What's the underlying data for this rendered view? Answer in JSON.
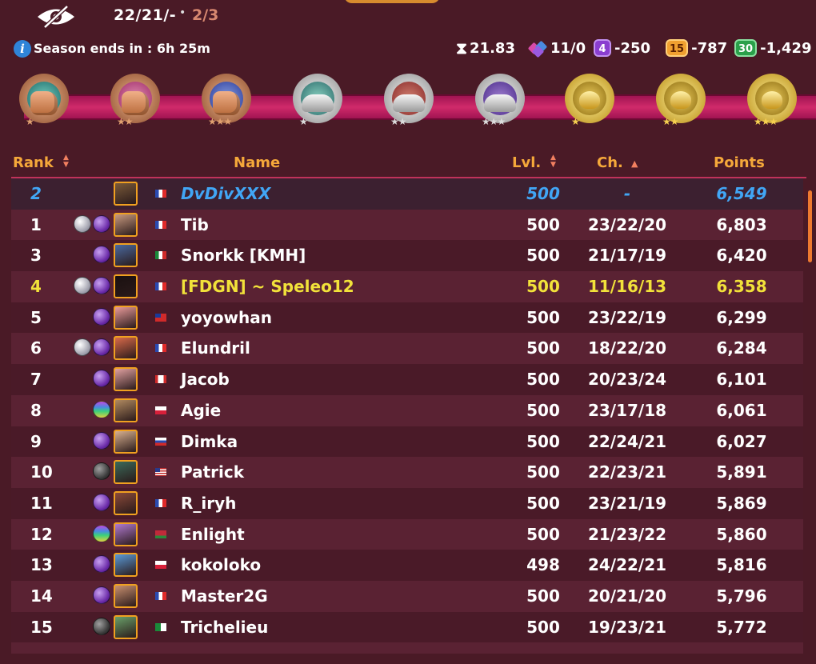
{
  "header": {
    "challenges": "22/21/-",
    "progress": "2/3",
    "season_label": "Season ends in : 6h 25m",
    "stats": [
      {
        "icon": "hourglass-icon",
        "value": "21.83"
      },
      {
        "icon": "gems-icon",
        "value": "11/0"
      },
      {
        "badge": "4",
        "badge_color": "#8a3ecf",
        "value": "-250"
      },
      {
        "badge": "15",
        "badge_color": "#f0a030",
        "value": "-787"
      },
      {
        "badge": "30",
        "badge_color": "#2aa04a",
        "value": "-1,429"
      }
    ]
  },
  "columns": {
    "rank": "Rank",
    "name": "Name",
    "lvl": "Lvl.",
    "ch": "Ch.",
    "points": "Points"
  },
  "rows": [
    {
      "rank": "2",
      "name": "DvDivXXX",
      "lvl": "500",
      "ch": "-",
      "points": "6,549",
      "style": "me",
      "orbs": [],
      "avatar": "#7a5a3a",
      "flag": "fr"
    },
    {
      "rank": "1",
      "name": "Tib",
      "lvl": "500",
      "ch": "23/22/20",
      "points": "6,803",
      "style": "",
      "orbs": [
        "silver",
        "purple"
      ],
      "avatar": "#c89a80",
      "flag": "fr"
    },
    {
      "rank": "3",
      "name": "Snorkk [KMH]",
      "lvl": "500",
      "ch": "21/17/19",
      "points": "6,420",
      "style": "",
      "orbs": [
        "purple"
      ],
      "avatar": "#4a6aa0",
      "flag": "mx"
    },
    {
      "rank": "4",
      "name": "[FDGN] ~ Speleo12",
      "lvl": "500",
      "ch": "11/16/13",
      "points": "6,358",
      "style": "highlight",
      "orbs": [
        "silver",
        "purple"
      ],
      "avatar": "#1a1010",
      "flag": "fr"
    },
    {
      "rank": "5",
      "name": "yoyowhan",
      "lvl": "500",
      "ch": "23/22/19",
      "points": "6,299",
      "style": "",
      "orbs": [
        "purple"
      ],
      "avatar": "#e89a9a",
      "flag": "tw"
    },
    {
      "rank": "6",
      "name": "Elundril",
      "lvl": "500",
      "ch": "18/22/20",
      "points": "6,284",
      "style": "",
      "orbs": [
        "silver",
        "purple"
      ],
      "avatar": "#d86a4a",
      "flag": "fr"
    },
    {
      "rank": "7",
      "name": "Jacob",
      "lvl": "500",
      "ch": "20/23/24",
      "points": "6,101",
      "style": "",
      "orbs": [
        "purple"
      ],
      "avatar": "#e0a0a0",
      "flag": "ca"
    },
    {
      "rank": "8",
      "name": "Agie",
      "lvl": "500",
      "ch": "23/17/18",
      "points": "6,061",
      "style": "",
      "orbs": [
        "rainbow"
      ],
      "avatar": "#b08a60",
      "flag": "pl"
    },
    {
      "rank": "9",
      "name": "Dimka",
      "lvl": "500",
      "ch": "22/24/21",
      "points": "6,027",
      "style": "",
      "orbs": [
        "purple"
      ],
      "avatar": "#d8b090",
      "flag": "ru"
    },
    {
      "rank": "10",
      "name": "Patrick",
      "lvl": "500",
      "ch": "22/23/21",
      "points": "5,891",
      "style": "",
      "orbs": [
        "dark"
      ],
      "avatar": "#3a6a5a",
      "flag": "us"
    },
    {
      "rank": "11",
      "name": "R_iryh",
      "lvl": "500",
      "ch": "23/21/19",
      "points": "5,869",
      "style": "",
      "orbs": [
        "purple"
      ],
      "avatar": "#8a4a3a",
      "flag": "fr"
    },
    {
      "rank": "12",
      "name": "Enlight",
      "lvl": "500",
      "ch": "21/23/22",
      "points": "5,860",
      "style": "",
      "orbs": [
        "rainbow"
      ],
      "avatar": "#b07ad0",
      "flag": "by"
    },
    {
      "rank": "13",
      "name": "kokoloko",
      "lvl": "498",
      "ch": "24/22/21",
      "points": "5,816",
      "style": "",
      "orbs": [
        "purple"
      ],
      "avatar": "#5a9ad8",
      "flag": "pl"
    },
    {
      "rank": "14",
      "name": "Master2G",
      "lvl": "500",
      "ch": "20/21/20",
      "points": "5,796",
      "style": "",
      "orbs": [
        "purple"
      ],
      "avatar": "#c89070",
      "flag": "fr"
    },
    {
      "rank": "15",
      "name": "Trichelieu",
      "lvl": "500",
      "ch": "19/23/21",
      "points": "5,772",
      "style": "",
      "orbs": [
        "dark"
      ],
      "avatar": "#6aa06a",
      "flag": "dz"
    }
  ]
}
